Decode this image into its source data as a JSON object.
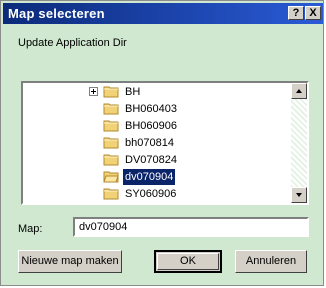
{
  "window": {
    "title": "Map selecteren",
    "help_label": "?",
    "close_label": "X"
  },
  "subtitle": "Update Application Dir",
  "tree": {
    "items": [
      {
        "label": "BH",
        "expandable": true,
        "selected": false
      },
      {
        "label": "BH060403",
        "expandable": false,
        "selected": false
      },
      {
        "label": "BH060906",
        "expandable": false,
        "selected": false
      },
      {
        "label": "bh070814",
        "expandable": false,
        "selected": false
      },
      {
        "label": "DV070824",
        "expandable": false,
        "selected": false
      },
      {
        "label": "dv070904",
        "expandable": false,
        "selected": true
      },
      {
        "label": "SY060906",
        "expandable": false,
        "selected": false
      }
    ]
  },
  "map": {
    "label": "Map:",
    "value": "dv070904"
  },
  "buttons": {
    "new_folder": "Nieuwe map maken",
    "ok": "OK",
    "cancel": "Annuleren"
  },
  "colors": {
    "title_start": "#0b2a7a",
    "title_end": "#2a5bd6",
    "dialog_bg": "#cfe8cf",
    "selection": "#0a246a"
  },
  "icons": {
    "folder": "folder-icon",
    "expand": "plus-box-icon"
  }
}
